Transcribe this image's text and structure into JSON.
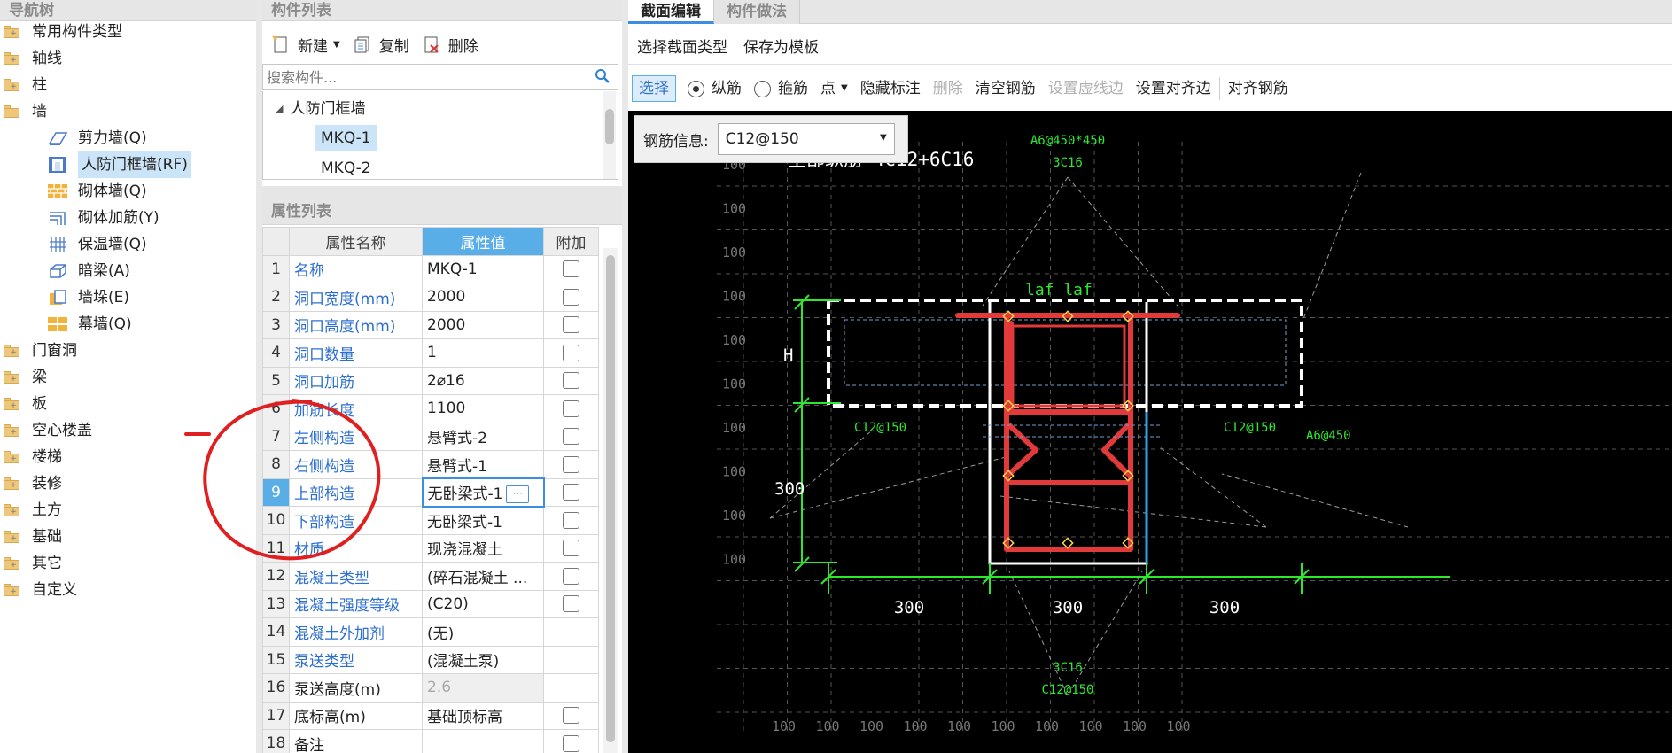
{
  "nav": {
    "title": "导航树",
    "items": [
      {
        "label": "常用构件类型",
        "icon": "folder-icon"
      },
      {
        "label": "轴线",
        "icon": "folder-icon"
      },
      {
        "label": "柱",
        "icon": "folder-icon"
      },
      {
        "label": "墙",
        "icon": "folder-open-icon"
      },
      {
        "label": "剪力墙(Q)",
        "icon": "shear-wall-icon"
      },
      {
        "label": "人防门框墙(RF)",
        "icon": "civil-defense-wall-icon"
      },
      {
        "label": "砌体墙(Q)",
        "icon": "masonry-wall-icon"
      },
      {
        "label": "砌体加筋(Y)",
        "icon": "masonry-rebar-icon"
      },
      {
        "label": "保温墙(Q)",
        "icon": "insulation-wall-icon"
      },
      {
        "label": "暗梁(A)",
        "icon": "hidden-beam-icon"
      },
      {
        "label": "墙垛(E)",
        "icon": "wall-pier-icon"
      },
      {
        "label": "幕墙(Q)",
        "icon": "curtain-wall-icon"
      },
      {
        "label": "门窗洞",
        "icon": "folder-icon"
      },
      {
        "label": "梁",
        "icon": "folder-icon"
      },
      {
        "label": "板",
        "icon": "folder-icon"
      },
      {
        "label": "空心楼盖",
        "icon": "folder-icon"
      },
      {
        "label": "楼梯",
        "icon": "folder-icon"
      },
      {
        "label": "装修",
        "icon": "folder-icon"
      },
      {
        "label": "土方",
        "icon": "folder-icon"
      },
      {
        "label": "基础",
        "icon": "folder-icon"
      },
      {
        "label": "其它",
        "icon": "folder-icon"
      },
      {
        "label": "自定义",
        "icon": "folder-icon"
      }
    ]
  },
  "complist": {
    "title": "构件列表",
    "new_label": "新建",
    "copy_label": "复制",
    "delete_label": "删除",
    "search_placeholder": "搜索构件...",
    "group": "人防门框墙",
    "items": [
      "MKQ-1",
      "MKQ-2"
    ]
  },
  "props": {
    "title": "属性列表",
    "headers": [
      "属性名称",
      "属性值",
      "附加"
    ],
    "rows": [
      {
        "n": "1",
        "name": "名称",
        "value": "MKQ-1"
      },
      {
        "n": "2",
        "name": "洞口宽度(mm)",
        "value": "2000"
      },
      {
        "n": "3",
        "name": "洞口高度(mm)",
        "value": "2000"
      },
      {
        "n": "4",
        "name": "洞口数量",
        "value": "1"
      },
      {
        "n": "5",
        "name": "洞口加筋",
        "value": "2⌀16"
      },
      {
        "n": "6",
        "name": "加筋长度",
        "value": "1100"
      },
      {
        "n": "7",
        "name": "左侧构造",
        "value": "悬臂式-2"
      },
      {
        "n": "8",
        "name": "右侧构造",
        "value": "悬臂式-1"
      },
      {
        "n": "9",
        "name": "上部构造",
        "value": "无卧梁式-1"
      },
      {
        "n": "10",
        "name": "下部构造",
        "value": "无卧梁式-1"
      },
      {
        "n": "11",
        "name": "材质",
        "value": "现浇混凝土"
      },
      {
        "n": "12",
        "name": "混凝土类型",
        "value": "(碎石混凝土 ..."
      },
      {
        "n": "13",
        "name": "混凝土强度等级",
        "value": "(C20)"
      },
      {
        "n": "14",
        "name": "混凝土外加剂",
        "value": "(无)"
      },
      {
        "n": "15",
        "name": "泵送类型",
        "value": "(混凝土泵)"
      },
      {
        "n": "16",
        "name": "泵送高度(m)",
        "value": "2.6"
      },
      {
        "n": "17",
        "name": "底标高(m)",
        "value": "基础顶标高"
      },
      {
        "n": "18",
        "name": "备注",
        "value": ""
      }
    ],
    "ellipsis": "···"
  },
  "editor": {
    "tabs": [
      "截面编辑",
      "构件做法"
    ],
    "row1": [
      "选择截面类型",
      "保存为模板"
    ],
    "select_label": "选择",
    "radio_longitudinal": "纵筋",
    "radio_stirrup": "箍筋",
    "point_label": "点",
    "hide_label": "隐藏标注",
    "delete_label": "删除",
    "clear_label": "清空钢筋",
    "set_dashed_label": "设置虚线边",
    "set_align_label": "设置对齐边",
    "align_rebar_label": "对齐钢筋",
    "rebar_info_label": "钢筋信息:",
    "rebar_info_value": "C12@150"
  },
  "drawing": {
    "grid_label": "100",
    "top_label_1": "A6@450*450",
    "top_label_2": "3C16",
    "all_longitudinal": "全部纵筋 4C12+6C16",
    "laf": "laf  laf",
    "h_label": "H",
    "dim_300": "300",
    "left_rebar": "C12@150",
    "right_rebar": "C12@150",
    "right_stirrup": "A6@450",
    "bottom_label_1": "3C16",
    "bottom_label_2": "C12@150"
  },
  "colors": {
    "accent": "#5aaee8",
    "link": "#2c6fd0",
    "rebar_red": "#e23a3a",
    "annotation_green": "#2ee82e"
  }
}
